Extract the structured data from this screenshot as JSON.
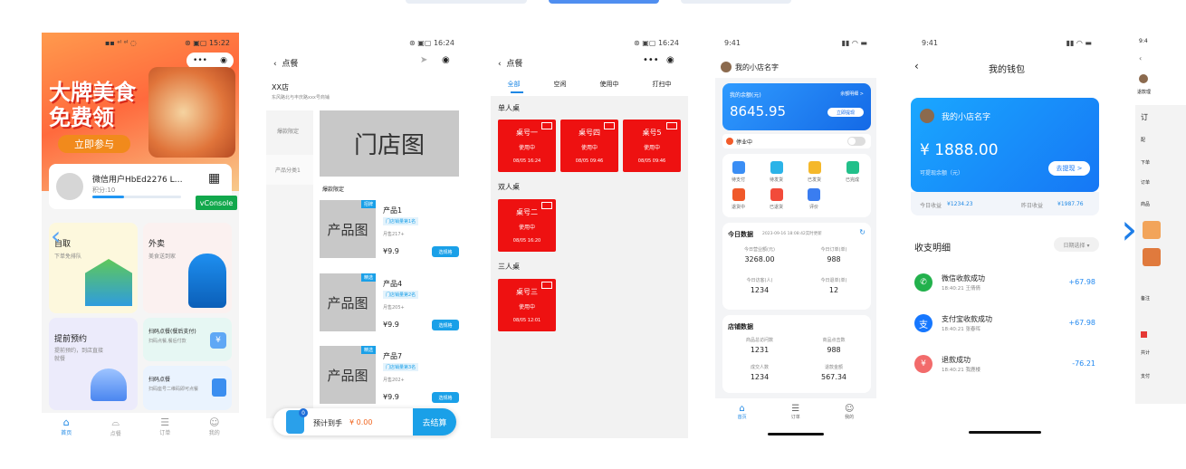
{
  "tabs": [
    "",
    "",
    ""
  ],
  "p1": {
    "status_left": "▪▪ ᵊˡ ᵊˡ ◌",
    "status_right": "⊛ ▣▢ 15:22",
    "banner_title1": "大牌美食",
    "banner_title2": "免费领",
    "banner_btn": "立即参与",
    "user_name": "微信用户HbEd2276 L…",
    "points": "积分:10",
    "vconsole": "vConsole",
    "tiles": [
      {
        "title": "自取",
        "sub": "下单免排队"
      },
      {
        "title": "外卖",
        "sub": "美食送到家"
      },
      {
        "title": "提前预约",
        "sub": "提前预约，到店直接就餐"
      },
      {
        "title": "扫码点餐(餐后支付)",
        "sub": "扫码点餐,餐后付款"
      },
      {
        "title": "扫码点餐",
        "sub": "扫码座号二维码即可点餐"
      }
    ],
    "nav": [
      "首页",
      "点餐",
      "订单",
      "我的"
    ]
  },
  "p2": {
    "status_right": "⊛ ▣▢ 16:24",
    "title": "点餐",
    "store": "XX店",
    "address": "东风路北与丰庆路xxx号商铺",
    "cats": [
      "爆款限定",
      "产品分类1"
    ],
    "store_img": "门店图",
    "section": "爆款限定",
    "products": [
      {
        "badge": "招牌",
        "name": "产品1",
        "tag": "门店销量第1名",
        "sold": "月售217+",
        "price": "¥9.9",
        "btn": "选规格",
        "img": "产品图"
      },
      {
        "badge": "精选",
        "name": "产品4",
        "tag": "门店销量第2名",
        "sold": "月售205+",
        "price": "¥9.9",
        "btn": "选规格",
        "img": "产品图"
      },
      {
        "badge": "精选",
        "name": "产品7",
        "tag": "门店销量第3名",
        "sold": "月售202+",
        "price": "¥9.9",
        "btn": "选规格",
        "img": "产品图"
      }
    ],
    "cart_badge": "0",
    "cart_label": "预计到手",
    "cart_amount": "¥ 0.00",
    "checkout": "去结算"
  },
  "p3": {
    "status_right": "⊛ ▣▢ 16:24",
    "title": "点餐",
    "tabs": [
      "全部",
      "空闲",
      "使用中",
      "打扫中"
    ],
    "groups": [
      {
        "name": "单人桌",
        "tables": [
          {
            "name": "桌号一",
            "state": "使用中",
            "time": "08/05 16:24"
          },
          {
            "name": "桌号四",
            "state": "使用中",
            "time": "08/05 09:46"
          },
          {
            "name": "桌号5",
            "state": "使用中",
            "time": "08/05 09:46"
          }
        ]
      },
      {
        "name": "双人桌",
        "tables": [
          {
            "name": "桌号二",
            "state": "使用中",
            "time": "08/05 16:20"
          }
        ]
      },
      {
        "name": "三人桌",
        "tables": [
          {
            "name": "桌号三",
            "state": "使用中",
            "time": "08/05 12:01"
          }
        ]
      }
    ]
  },
  "p4": {
    "time": "9:41",
    "shop": "我的小店名字",
    "balance_label": "我的余额(元)",
    "balance_link": "余额明细 >",
    "balance": "8645.95",
    "withdraw": "立即提现",
    "business": "停业中",
    "icons": [
      "待支付",
      "待发货",
      "已发货",
      "已完成",
      "退货中",
      "已退货",
      "评价"
    ],
    "today_title": "今日数据",
    "today_time": "2023-09-16  18:08:42实时更新",
    "today": [
      {
        "label": "今日营业额(元)",
        "value": "3268.00"
      },
      {
        "label": "今日订单(单)",
        "value": "988"
      },
      {
        "label": "今日访客(人)",
        "value": "1234"
      },
      {
        "label": "今日退单(单)",
        "value": "12"
      }
    ],
    "store_title": "店铺数据",
    "store": [
      {
        "label": "商品总访问数",
        "value": "1231"
      },
      {
        "label": "商品点击数",
        "value": "988"
      },
      {
        "label": "成交人数",
        "value": "1234"
      },
      {
        "label": "退款金额",
        "value": "567.34"
      }
    ],
    "nav": [
      "首页",
      "订单",
      "我的"
    ]
  },
  "p5": {
    "time": "9:41",
    "title": "我的钱包",
    "shop": "我的小店名字",
    "amount": "¥ 1888.00",
    "withdrawable": "可提现余额（元）",
    "withdraw_btn": "去提现 >",
    "today_income_label": "今日收益",
    "today_income": "¥1234.23",
    "yesterday_label": "昨日收益",
    "yesterday": "¥1987.76",
    "detail_title": "收支明细",
    "date_select": "日期选择 ▾",
    "records": [
      {
        "title": "微信收款成功",
        "meta": "18:40:21  王倩倩",
        "amount": "+67.98",
        "color": "#22b14c"
      },
      {
        "title": "支付宝收款成功",
        "meta": "18:40:21  张春晖",
        "amount": "+67.98",
        "color": "#1677ff"
      },
      {
        "title": "退款成功",
        "meta": "18:40:21  我鹿楼",
        "amount": "-76.21",
        "color": "#f26b6b"
      }
    ]
  },
  "p6": {
    "time": "9:4",
    "labels": [
      "退款理",
      "订",
      "配",
      "下单",
      "订单",
      "商品",
      "备注",
      "共计",
      "支付"
    ]
  }
}
